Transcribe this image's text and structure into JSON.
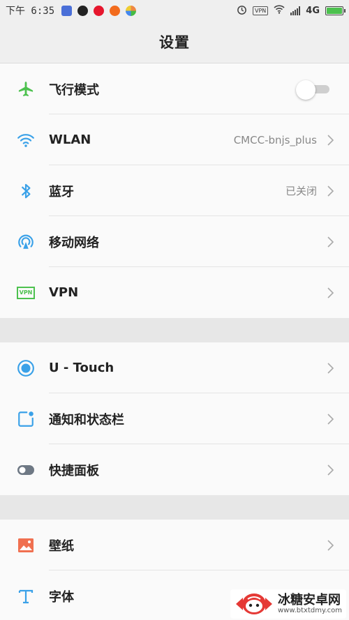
{
  "status_bar": {
    "time": "下午 6:35",
    "network": "4G",
    "vpn_badge": "VPN",
    "battery_color": "#4cc14e"
  },
  "header": {
    "title": "设置"
  },
  "groups": [
    {
      "items": [
        {
          "label": "飞行模式",
          "icon": "airplane-icon",
          "icon_color": "#4cc14e",
          "control": "toggle",
          "toggle_on": false
        },
        {
          "label": "WLAN",
          "icon": "wifi-icon",
          "icon_color": "#3aa1e8",
          "value": "CMCC-bnjs_plus"
        },
        {
          "label": "蓝牙",
          "icon": "bluetooth-icon",
          "icon_color": "#3aa1e8",
          "value": "已关闭"
        },
        {
          "label": "移动网络",
          "icon": "mobile-network-icon",
          "icon_color": "#3aa1e8"
        },
        {
          "label": "VPN",
          "icon": "vpn-icon",
          "icon_color": "#4cc14e",
          "icon_text": "VPN"
        }
      ]
    },
    {
      "items": [
        {
          "label": "U - Touch",
          "icon": "u-touch-icon",
          "icon_color": "#3aa1e8"
        },
        {
          "label": "通知和状态栏",
          "icon": "notification-icon",
          "icon_color": "#3aa1e8"
        },
        {
          "label": "快捷面板",
          "icon": "quick-panel-icon",
          "icon_color": "#6e7884"
        }
      ]
    },
    {
      "items": [
        {
          "label": "壁纸",
          "icon": "wallpaper-icon",
          "icon_color": "#f07050"
        },
        {
          "label": "字体",
          "icon": "font-icon",
          "icon_color": "#3aa1e8"
        }
      ]
    }
  ],
  "watermark": {
    "title": "冰糖安卓网",
    "url": "www.btxtdmy.com"
  }
}
